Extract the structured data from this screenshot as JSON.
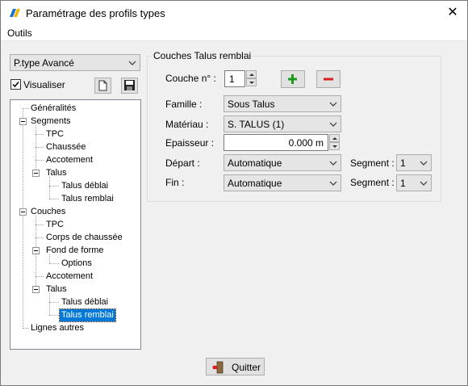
{
  "window": {
    "title": "Paramétrage des profils types",
    "close_glyph": "✕"
  },
  "menu": {
    "outils": "Outils"
  },
  "left": {
    "profile_select": "P.type Avancé",
    "visualiser": "Visualiser",
    "visualiser_checked": true
  },
  "tree": {
    "generalites": "Généralités",
    "segments": "Segments",
    "seg_tpc": "TPC",
    "seg_chaussee": "Chaussée",
    "seg_accotement": "Accotement",
    "seg_talus": "Talus",
    "seg_talus_deblai": "Talus déblai",
    "seg_talus_remblai": "Talus remblai",
    "couches": "Couches",
    "c_tpc": "TPC",
    "c_corps": "Corps de chaussée",
    "c_fond": "Fond de forme",
    "c_options": "Options",
    "c_accotement": "Accotement",
    "c_talus": "Talus",
    "c_talus_deblai": "Talus déblai",
    "c_talus_remblai": "Talus remblai",
    "lignes_autres": "Lignes autres"
  },
  "group": {
    "title": "Couches Talus remblai",
    "couche_label": "Couche n° :",
    "couche_value": "1",
    "famille_label": "Famille :",
    "famille_value": "Sous Talus",
    "materiau_label": "Matériau :",
    "materiau_value": "S. TALUS (1)",
    "epaisseur_label": "Epaisseur :",
    "epaisseur_value": "0.000 m",
    "depart_label": "Départ :",
    "depart_value": "Automatique",
    "fin_label": "Fin :",
    "fin_value": "Automatique",
    "segment_label": "Segment :",
    "segment_depart_value": "1",
    "segment_fin_value": "1"
  },
  "footer": {
    "quitter": "Quitter"
  },
  "colors": {
    "add": "#1a9b1a",
    "remove": "#d81e1e",
    "selection": "#0078d7"
  }
}
